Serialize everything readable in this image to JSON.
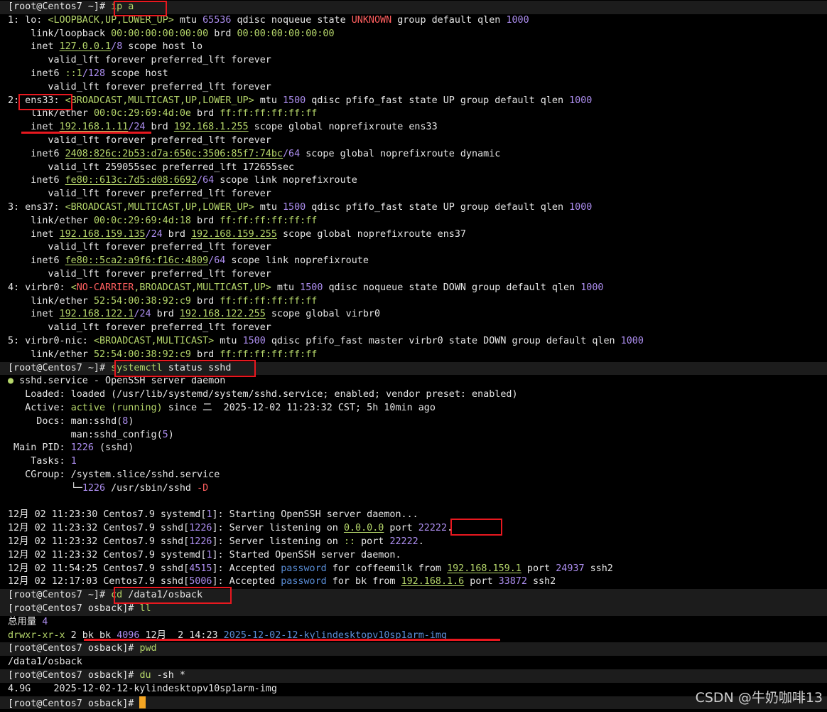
{
  "terminal": {
    "lines": [
      {
        "s": [
          [
            "[root@Centos7 ~]# ",
            ""
          ],
          [
            "ip a",
            "g"
          ]
        ],
        "prompt": true
      },
      {
        "s": [
          [
            "1: lo: ",
            ""
          ],
          [
            "<LOOPBACK,UP,LOWER_UP>",
            "g"
          ],
          [
            " mtu ",
            ""
          ],
          [
            "65536",
            "v"
          ],
          [
            " qdisc noqueue state ",
            ""
          ],
          [
            "UNKNOWN",
            "r"
          ],
          [
            " group default qlen ",
            ""
          ],
          [
            "1000",
            "v"
          ]
        ]
      },
      {
        "s": [
          [
            "    link/loopback ",
            ""
          ],
          [
            "00:00:00:00:00:00",
            "g"
          ],
          [
            " brd ",
            ""
          ],
          [
            "00:00:00:00:00:00",
            "g"
          ]
        ]
      },
      {
        "s": [
          [
            "    inet ",
            ""
          ],
          [
            "127.0.0.1",
            "gu"
          ],
          [
            "/",
            "v"
          ],
          [
            "8",
            "v"
          ],
          [
            " scope host lo",
            ""
          ]
        ]
      },
      {
        "s": [
          [
            "       valid_lft forever preferred_lft forever",
            ""
          ]
        ]
      },
      {
        "s": [
          [
            "    inet6 ",
            ""
          ],
          [
            "::1",
            "g"
          ],
          [
            "/",
            "v"
          ],
          [
            "128",
            "v"
          ],
          [
            " scope host",
            ""
          ]
        ]
      },
      {
        "s": [
          [
            "       valid_lft forever preferred_lft forever",
            ""
          ]
        ]
      },
      {
        "s": [
          [
            "2: ens33: ",
            ""
          ],
          [
            "<BROADCAST,MULTICAST,UP,LOWER_UP>",
            "g"
          ],
          [
            " mtu ",
            ""
          ],
          [
            "1500",
            "v"
          ],
          [
            " qdisc pfifo_fast state UP group default qlen ",
            ""
          ],
          [
            "1000",
            "v"
          ]
        ]
      },
      {
        "s": [
          [
            "    link/ether ",
            ""
          ],
          [
            "00:0c:29:69:4d:0e",
            "g"
          ],
          [
            " brd ",
            ""
          ],
          [
            "ff:ff:ff:ff:ff:ff",
            "g"
          ]
        ]
      },
      {
        "s": [
          [
            "    inet ",
            ""
          ],
          [
            "192.168.1.11",
            "gu"
          ],
          [
            "/",
            "v"
          ],
          [
            "24",
            "v"
          ],
          [
            " brd ",
            ""
          ],
          [
            "192.168.1.255",
            "gu"
          ],
          [
            " scope global noprefixroute ens33",
            ""
          ]
        ]
      },
      {
        "s": [
          [
            "       valid_lft forever preferred_lft forever",
            ""
          ]
        ]
      },
      {
        "s": [
          [
            "    inet6 ",
            ""
          ],
          [
            "2408:826c:2b53:d7a:650c:3506:85f7:74bc",
            "gu"
          ],
          [
            "/",
            "v"
          ],
          [
            "64",
            "v"
          ],
          [
            " scope global noprefixroute dynamic",
            ""
          ]
        ]
      },
      {
        "s": [
          [
            "       valid_lft 259055sec preferred_lft 172655sec",
            ""
          ]
        ]
      },
      {
        "s": [
          [
            "    inet6 ",
            ""
          ],
          [
            "fe80::613c:7d5:d08:6692",
            "gu"
          ],
          [
            "/",
            "v"
          ],
          [
            "64",
            "v"
          ],
          [
            " scope link noprefixroute",
            ""
          ]
        ]
      },
      {
        "s": [
          [
            "       valid_lft forever preferred_lft forever",
            ""
          ]
        ]
      },
      {
        "s": [
          [
            "3: ens37: ",
            ""
          ],
          [
            "<BROADCAST,MULTICAST,UP,LOWER_UP>",
            "g"
          ],
          [
            " mtu ",
            ""
          ],
          [
            "1500",
            "v"
          ],
          [
            " qdisc pfifo_fast state UP group default qlen ",
            ""
          ],
          [
            "1000",
            "v"
          ]
        ]
      },
      {
        "s": [
          [
            "    link/ether ",
            ""
          ],
          [
            "00:0c:29:69:4d:18",
            "g"
          ],
          [
            " brd ",
            ""
          ],
          [
            "ff:ff:ff:ff:ff:ff",
            "g"
          ]
        ]
      },
      {
        "s": [
          [
            "    inet ",
            ""
          ],
          [
            "192.168.159.135",
            "gu"
          ],
          [
            "/",
            "v"
          ],
          [
            "24",
            "v"
          ],
          [
            " brd ",
            ""
          ],
          [
            "192.168.159.255",
            "gu"
          ],
          [
            " scope global noprefixroute ens37",
            ""
          ]
        ]
      },
      {
        "s": [
          [
            "       valid_lft forever preferred_lft forever",
            ""
          ]
        ]
      },
      {
        "s": [
          [
            "    inet6 ",
            ""
          ],
          [
            "fe80::5ca2:a9f6:f16c:4809",
            "gu"
          ],
          [
            "/",
            "v"
          ],
          [
            "64",
            "v"
          ],
          [
            " scope link noprefixroute",
            ""
          ]
        ]
      },
      {
        "s": [
          [
            "       valid_lft forever preferred_lft forever",
            ""
          ]
        ]
      },
      {
        "s": [
          [
            "4: virbr0: ",
            ""
          ],
          [
            "<",
            "g"
          ],
          [
            "NO-CARRIER",
            "r"
          ],
          [
            ",BROADCAST,MULTICAST,UP>",
            "g"
          ],
          [
            " mtu ",
            ""
          ],
          [
            "1500",
            "v"
          ],
          [
            " qdisc noqueue state DOWN group default qlen ",
            ""
          ],
          [
            "1000",
            "v"
          ]
        ]
      },
      {
        "s": [
          [
            "    link/ether ",
            ""
          ],
          [
            "52:54:00:38:92:c9",
            "g"
          ],
          [
            " brd ",
            ""
          ],
          [
            "ff:ff:ff:ff:ff:ff",
            "g"
          ]
        ]
      },
      {
        "s": [
          [
            "    inet ",
            ""
          ],
          [
            "192.168.122.1",
            "gu"
          ],
          [
            "/",
            "v"
          ],
          [
            "24",
            "v"
          ],
          [
            " brd ",
            ""
          ],
          [
            "192.168.122.255",
            "gu"
          ],
          [
            " scope global virbr0",
            ""
          ]
        ]
      },
      {
        "s": [
          [
            "       valid_lft forever preferred_lft forever",
            ""
          ]
        ]
      },
      {
        "s": [
          [
            "5: virbr0-nic: ",
            ""
          ],
          [
            "<BROADCAST,MULTICAST>",
            "g"
          ],
          [
            " mtu ",
            ""
          ],
          [
            "1500",
            "v"
          ],
          [
            " qdisc pfifo_fast master virbr0 state DOWN group default qlen ",
            ""
          ],
          [
            "1000",
            "v"
          ]
        ]
      },
      {
        "s": [
          [
            "    link/ether ",
            ""
          ],
          [
            "52:54:00:38:92:c9",
            "g"
          ],
          [
            " brd ",
            ""
          ],
          [
            "ff:ff:ff:ff:ff:ff",
            "g"
          ]
        ]
      },
      {
        "s": [
          [
            "[root@Centos7 ~]# ",
            ""
          ],
          [
            "systemctl",
            "g"
          ],
          [
            " status sshd",
            ""
          ]
        ],
        "prompt": true
      },
      {
        "s": [
          [
            "● ",
            "g"
          ],
          [
            "sshd.service - OpenSSH server daemon",
            ""
          ]
        ]
      },
      {
        "s": [
          [
            "   Loaded: loaded (/usr/lib/systemd/system/sshd.service; enabled; vendor preset: enabled)",
            ""
          ]
        ]
      },
      {
        "s": [
          [
            "   Active: ",
            ""
          ],
          [
            "active (running)",
            "g"
          ],
          [
            " since 二  2025-12-02 11:23:32 CST; 5h 10min ago",
            ""
          ]
        ]
      },
      {
        "s": [
          [
            "     Docs: man:sshd(",
            ""
          ],
          [
            "8",
            "v"
          ],
          [
            ")",
            ""
          ]
        ]
      },
      {
        "s": [
          [
            "           man:sshd_config(",
            ""
          ],
          [
            "5",
            "v"
          ],
          [
            ")",
            ""
          ]
        ]
      },
      {
        "s": [
          [
            " Main PID: ",
            ""
          ],
          [
            "1226",
            "v"
          ],
          [
            " (sshd)",
            ""
          ]
        ]
      },
      {
        "s": [
          [
            "    Tasks: ",
            ""
          ],
          [
            "1",
            "v"
          ]
        ]
      },
      {
        "s": [
          [
            "   CGroup: /system.slice/sshd.service",
            ""
          ]
        ]
      },
      {
        "s": [
          [
            "           └─",
            ""
          ],
          [
            "1226",
            "v"
          ],
          [
            " /usr/sbin/sshd ",
            ""
          ],
          [
            "-D",
            "r"
          ]
        ]
      },
      {
        "s": [
          [
            "",
            ""
          ]
        ]
      },
      {
        "s": [
          [
            "12月 02 11:23:30 Centos7.9 systemd[",
            ""
          ],
          [
            "1",
            "v"
          ],
          [
            "]: Starting OpenSSH server daemon...",
            ""
          ]
        ]
      },
      {
        "s": [
          [
            "12月 02 11:23:32 Centos7.9 sshd[",
            ""
          ],
          [
            "1226",
            "v"
          ],
          [
            "]: Server listening on ",
            ""
          ],
          [
            "0.0.0.0",
            "gu"
          ],
          [
            " port ",
            ""
          ],
          [
            "22222",
            "v"
          ],
          [
            ".",
            ""
          ]
        ]
      },
      {
        "s": [
          [
            "12月 02 11:23:32 Centos7.9 sshd[",
            ""
          ],
          [
            "1226",
            "v"
          ],
          [
            "]: Server listening on ",
            ""
          ],
          [
            "::",
            "g"
          ],
          [
            " port ",
            ""
          ],
          [
            "22222",
            "v"
          ],
          [
            ".",
            ""
          ]
        ]
      },
      {
        "s": [
          [
            "12月 02 11:23:32 Centos7.9 systemd[",
            ""
          ],
          [
            "1",
            "v"
          ],
          [
            "]: Started OpenSSH server daemon.",
            ""
          ]
        ]
      },
      {
        "s": [
          [
            "12月 02 11:54:25 Centos7.9 sshd[",
            ""
          ],
          [
            "4515",
            "v"
          ],
          [
            "]: Accepted ",
            ""
          ],
          [
            "password",
            "b"
          ],
          [
            " for coffeemilk from ",
            ""
          ],
          [
            "192.168.159.1",
            "gu"
          ],
          [
            " port ",
            ""
          ],
          [
            "24937",
            "v"
          ],
          [
            " ssh2",
            ""
          ]
        ]
      },
      {
        "s": [
          [
            "12月 02 12:17:03 Centos7.9 sshd[",
            ""
          ],
          [
            "5006",
            "v"
          ],
          [
            "]: Accepted ",
            ""
          ],
          [
            "password",
            "b"
          ],
          [
            " for bk from ",
            ""
          ],
          [
            "192.168.1.6",
            "gu"
          ],
          [
            " port ",
            ""
          ],
          [
            "33872",
            "v"
          ],
          [
            " ssh2",
            ""
          ]
        ]
      },
      {
        "s": [
          [
            "[root@Centos7 ~]# ",
            ""
          ],
          [
            "cd",
            "g"
          ],
          [
            " /data1/osback",
            ""
          ]
        ],
        "prompt": true
      },
      {
        "s": [
          [
            "[root@Centos7 osback]# ",
            ""
          ],
          [
            "ll",
            "g"
          ]
        ],
        "prompt": true
      },
      {
        "s": [
          [
            "总用量 ",
            ""
          ],
          [
            "4",
            "v"
          ]
        ]
      },
      {
        "s": [
          [
            "drwxr-xr-x",
            "g"
          ],
          [
            " 2 bk bk ",
            ""
          ],
          [
            "4096",
            "v"
          ],
          [
            " 12月  2 14:23 ",
            ""
          ],
          [
            "2025-12-02-12-kylindesktopv10sp1arm-img",
            "b"
          ]
        ]
      },
      {
        "s": [
          [
            "[root@Centos7 osback]# ",
            ""
          ],
          [
            "pwd",
            "g"
          ]
        ],
        "prompt": true
      },
      {
        "s": [
          [
            "/data1/osback",
            ""
          ]
        ]
      },
      {
        "s": [
          [
            "[root@Centos7 osback]# ",
            ""
          ],
          [
            "du",
            "g"
          ],
          [
            " -sh *",
            ""
          ]
        ],
        "prompt": true
      },
      {
        "s": [
          [
            "4.9G    2025-12-02-12-kylindesktopv10sp1arm-img",
            ""
          ]
        ]
      },
      {
        "s": [
          [
            "[root@Centos7 osback]# ",
            ""
          ]
        ],
        "prompt": true,
        "cursor": true
      }
    ]
  },
  "watermark": "CSDN @牛奶咖啡13",
  "colors": {
    "background": "#000000",
    "text": "#e6e6e6",
    "green": "#b5d66a",
    "violet": "#ad8ef0",
    "blue": "#5a8dd6",
    "red": "#ff5f5f",
    "highlight": "#e8181f",
    "cursor": "#f5a623"
  }
}
